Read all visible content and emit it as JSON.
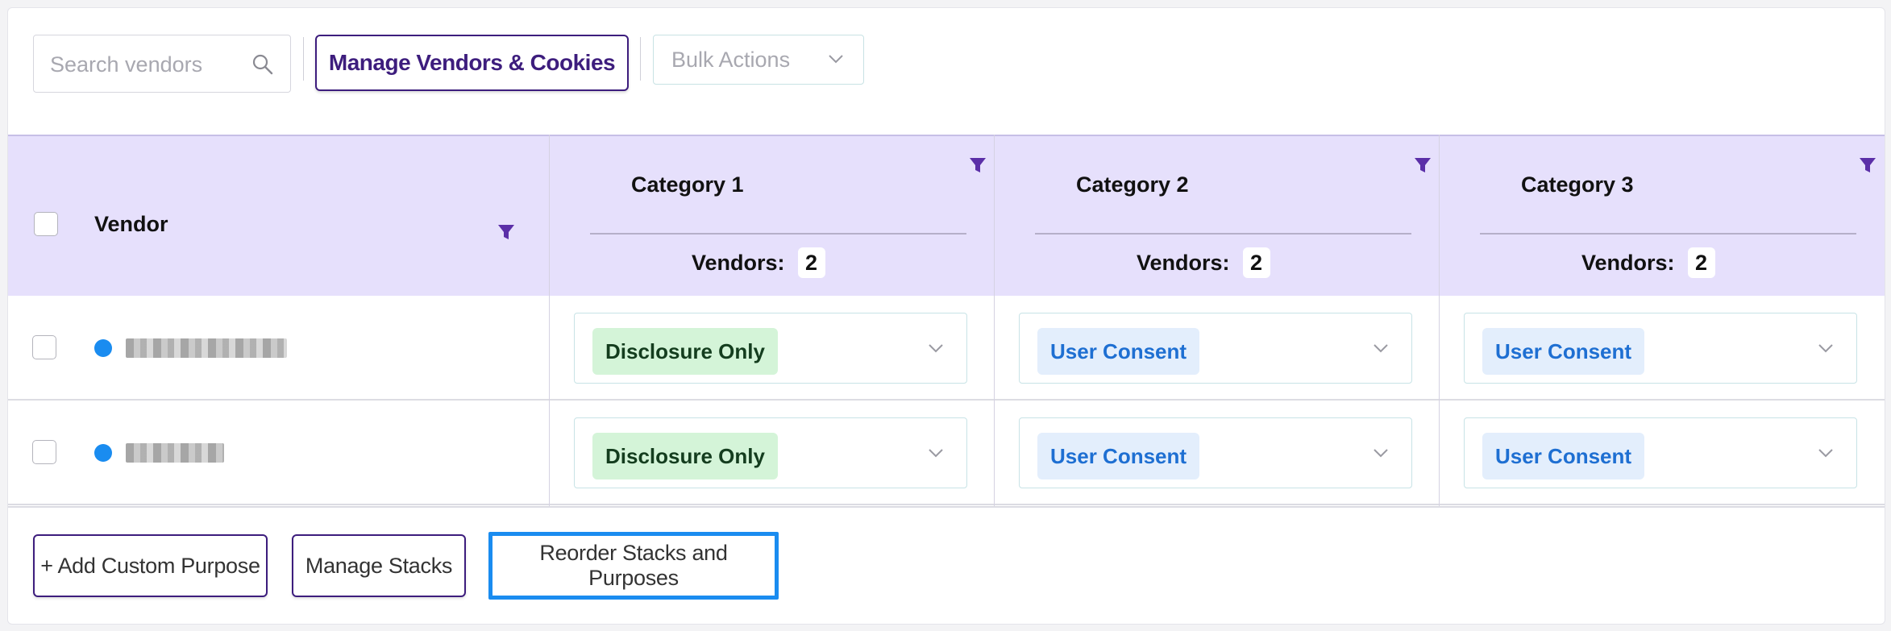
{
  "toolbar": {
    "search_placeholder": "Search vendors",
    "manage_button": "Manage Vendors & Cookies",
    "bulk_actions": "Bulk Actions"
  },
  "table": {
    "vendor_header": "Vendor",
    "categories": [
      {
        "name": "Category 1",
        "vendors_label": "Vendors:",
        "vendors_count": "2"
      },
      {
        "name": "Category 2",
        "vendors_label": "Vendors:",
        "vendors_count": "2"
      },
      {
        "name": "Category 3",
        "vendors_label": "Vendors:",
        "vendors_count": "2"
      }
    ],
    "rows": [
      {
        "vendor_status_color": "#1a8cf0",
        "values": [
          "Disclosure Only",
          "User Consent",
          "User Consent"
        ]
      },
      {
        "vendor_status_color": "#1a8cf0",
        "values": [
          "Disclosure Only",
          "User Consent",
          "User Consent"
        ]
      }
    ]
  },
  "footer": {
    "add_custom_purpose": "+ Add Custom Purpose",
    "manage_stacks": "Manage Stacks",
    "reorder": "Reorder Stacks and Purposes"
  },
  "colors": {
    "brand_purple": "#3d1d7d",
    "header_bg": "#e6e0fc",
    "focus_blue": "#1a8cf0",
    "disclosure_bg": "#d4f4d8",
    "consent_bg": "#e3eefc"
  },
  "icons": [
    "search-icon",
    "filter-icon",
    "chevron-down-icon"
  ]
}
